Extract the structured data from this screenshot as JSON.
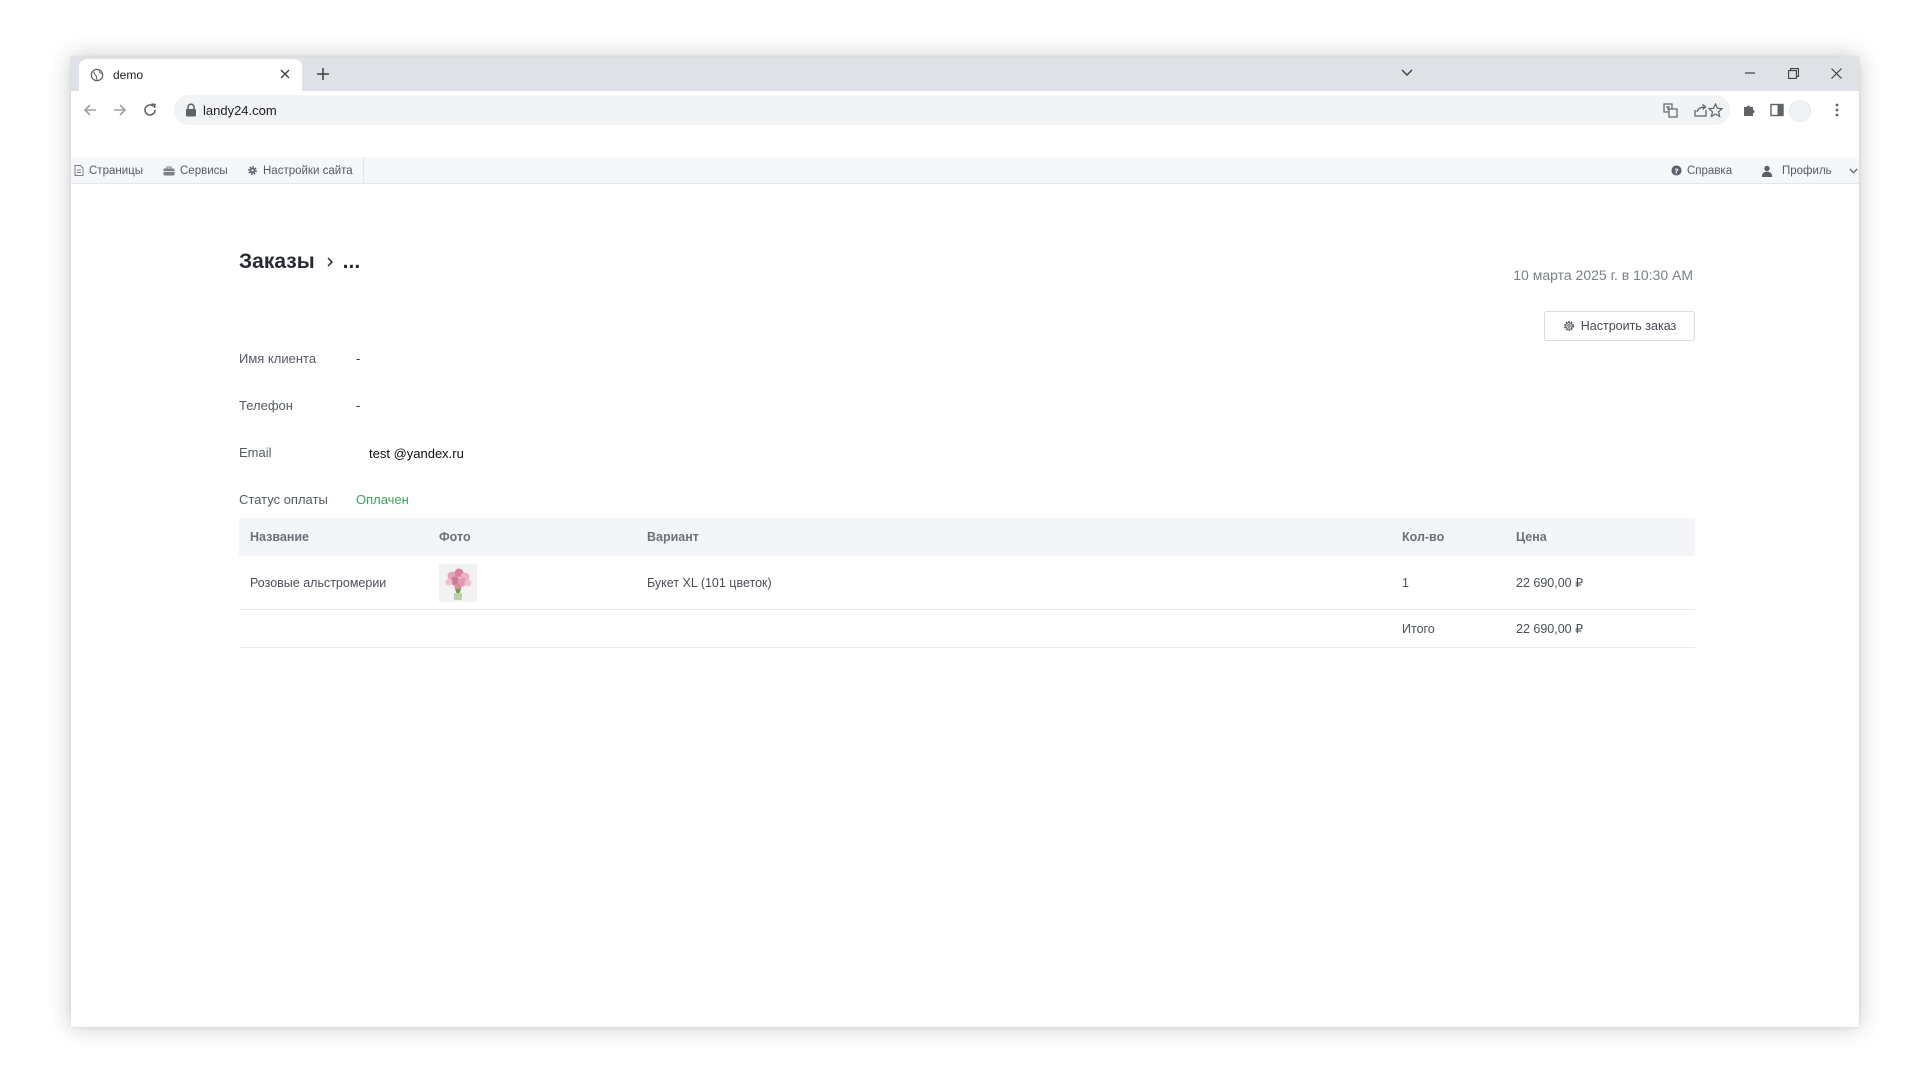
{
  "browser": {
    "tab_title": "demo",
    "url": "landy24.com"
  },
  "adminbar": {
    "pages": "Страницы",
    "services": "Сервисы",
    "site_settings": "Настройки сайта",
    "help": "Справка",
    "profile": "Профиль"
  },
  "order": {
    "breadcrumb_root": "Заказы",
    "breadcrumb_current": "...",
    "date": "10 марта 2025 г. в 10:30 AM",
    "configure_button": "Настроить заказ",
    "fields": {
      "client_name_label": "Имя клиента",
      "client_name_value": "-",
      "phone_label": "Телефон",
      "phone_value": "-",
      "email_label": "Email",
      "email_value": "test @yandex.ru",
      "payment_status_label": "Статус оплаты",
      "payment_status_value": "Оплачен"
    },
    "table": {
      "headers": [
        "Название",
        "Фото",
        "Вариант",
        "Кол-во",
        "Цена"
      ],
      "rows": [
        {
          "name": "Розовые альстромерии",
          "variant": "Букет XL (101 цветок)",
          "qty": "1",
          "price": "22 690,00 ₽"
        }
      ],
      "total_label": "Итого",
      "total_value": "22 690,00 ₽"
    }
  },
  "colors": {
    "paid_status": "#3aa65c",
    "admin_bar_bg": "#f5f7fb",
    "table_header_bg": "#f3f5f8"
  }
}
